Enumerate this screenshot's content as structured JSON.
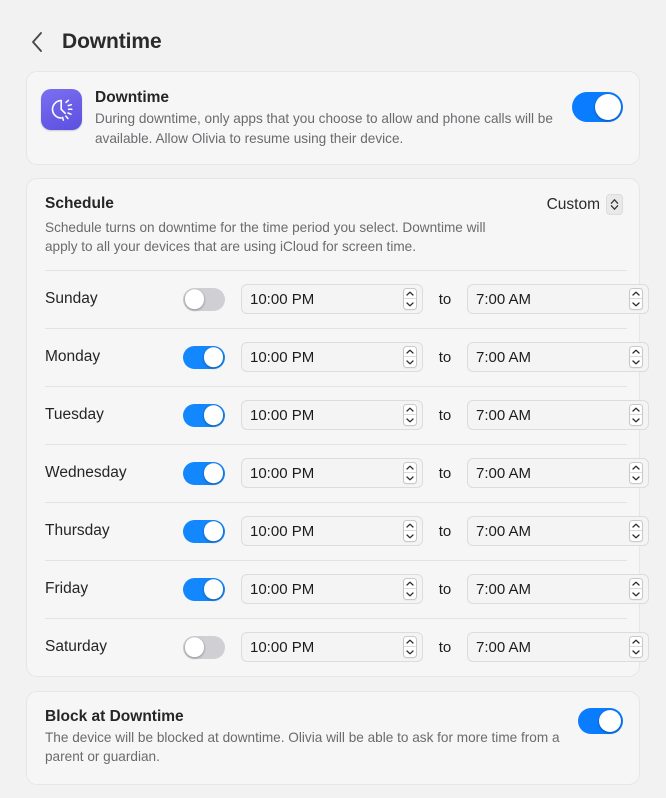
{
  "header": {
    "back_icon": "chevron-left-icon",
    "title": "Downtime"
  },
  "downtime_card": {
    "icon": "downtime-clock-icon",
    "title": "Downtime",
    "description": "During downtime, only apps that you choose to allow and phone calls will be available. Allow Olivia to resume using their device.",
    "toggle": {
      "state": "on",
      "on_color": "#0a7cff",
      "off_color": "#d6d6da"
    }
  },
  "schedule_card": {
    "title": "Schedule",
    "popup": {
      "value": "Custom",
      "icon": "chevron-up-down-icon"
    },
    "description": "Schedule turns on downtime for the time period you select. Downtime will apply to all your devices that are using iCloud for screen time.",
    "to_label": "to",
    "stepper_icon": "stepper-up-down-icon",
    "days": [
      {
        "label": "Sunday",
        "enabled": false,
        "start": "10:00 PM",
        "end": "7:00 AM"
      },
      {
        "label": "Monday",
        "enabled": true,
        "start": "10:00 PM",
        "end": "7:00 AM"
      },
      {
        "label": "Tuesday",
        "enabled": true,
        "start": "10:00 PM",
        "end": "7:00 AM"
      },
      {
        "label": "Wednesday",
        "enabled": true,
        "start": "10:00 PM",
        "end": "7:00 AM"
      },
      {
        "label": "Thursday",
        "enabled": true,
        "start": "10:00 PM",
        "end": "7:00 AM"
      },
      {
        "label": "Friday",
        "enabled": true,
        "start": "10:00 PM",
        "end": "7:00 AM"
      },
      {
        "label": "Saturday",
        "enabled": false,
        "start": "10:00 PM",
        "end": "7:00 AM"
      }
    ]
  },
  "block_card": {
    "title": "Block at Downtime",
    "description": "The device will be blocked at downtime. Olivia will be able to ask for more time from a parent or guardian.",
    "toggle": {
      "state": "on"
    }
  }
}
